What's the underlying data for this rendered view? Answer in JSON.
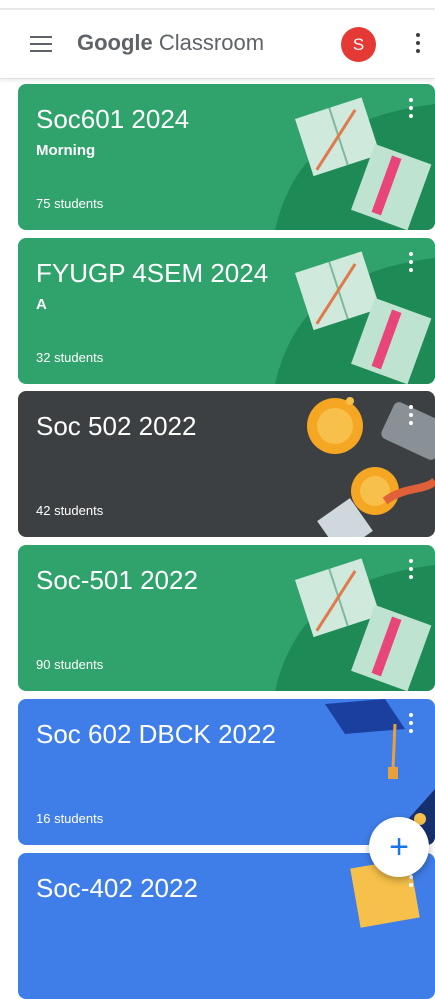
{
  "header": {
    "brand_google": "Google",
    "brand_classroom": "Classroom",
    "avatar_letter": "S"
  },
  "classes": [
    {
      "title": "Soc601 2024",
      "section": "Morning",
      "students": "75 students",
      "theme": "green"
    },
    {
      "title": "FYUGP 4SEM 2024",
      "section": "A",
      "students": "32 students",
      "theme": "green"
    },
    {
      "title": "Soc 502 2022",
      "section": "",
      "students": "42 students",
      "theme": "dark"
    },
    {
      "title": "Soc-501 2022",
      "section": "",
      "students": "90 students",
      "theme": "green"
    },
    {
      "title": "Soc 602 DBCK 2022",
      "section": "",
      "students": "16 students",
      "theme": "blue"
    },
    {
      "title": "Soc-402 2022",
      "section": "",
      "students": "",
      "theme": "blue"
    }
  ],
  "fab": {
    "icon": "+"
  },
  "colors": {
    "green": "#2fa36b",
    "dark": "#3c4043",
    "blue": "#3f7ee8",
    "avatar": "#e53935"
  }
}
